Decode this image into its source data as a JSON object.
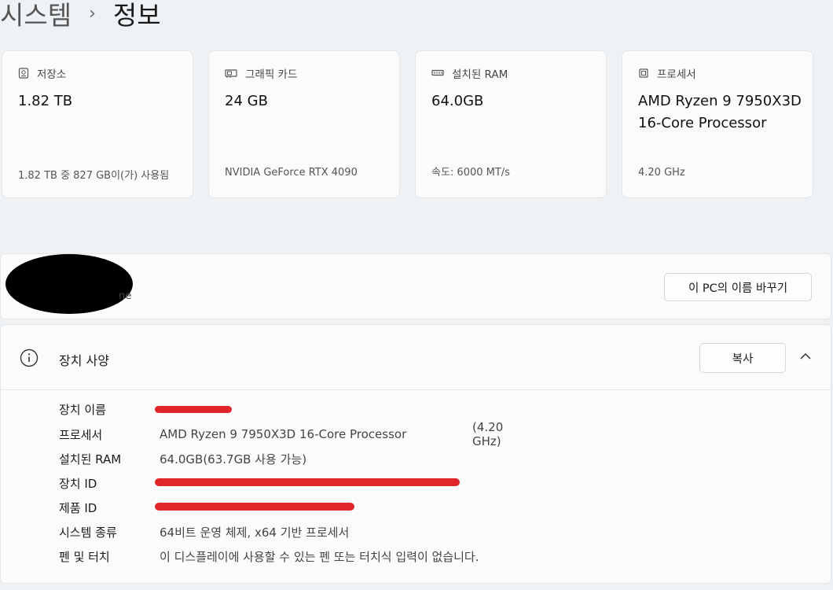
{
  "breadcrumb": {
    "parent": "시스템",
    "separator": "›",
    "current": "정보"
  },
  "cards": [
    {
      "icon": "storage-icon",
      "title": "저장소",
      "value": "1.82 TB",
      "sub": "1.82 TB 중 827 GB이(가) 사용됨"
    },
    {
      "icon": "graphics-card-icon",
      "title": "그래픽 카드",
      "value": "24 GB",
      "sub": "NVIDIA GeForce RTX 4090"
    },
    {
      "icon": "memory-icon",
      "title": "설치된 RAM",
      "value": "64.0GB",
      "sub": "속도: 6000 MT/s"
    },
    {
      "icon": "processor-icon",
      "title": "프로세서",
      "value": "AMD Ryzen 9 7950X3D 16-Core Processor",
      "sub": "4.20 GHz"
    }
  ],
  "pc_name": {
    "visible_tail": "ne",
    "rename_button": "이 PC의 이름 바꾸기"
  },
  "device_specs": {
    "title": "장치 사양",
    "copy_button": "복사",
    "rows": [
      {
        "label": "장치 이름",
        "value": ""
      },
      {
        "label": "프로세서",
        "value": "AMD Ryzen 9 7950X3D 16-Core Processor",
        "extra": "(4.20 GHz)"
      },
      {
        "label": "설치된 RAM",
        "value": "64.0GB(63.7GB 사용 가능)"
      },
      {
        "label": "장치 ID",
        "value": ""
      },
      {
        "label": "제품 ID",
        "value": ""
      },
      {
        "label": "시스템 종류",
        "value": "64비트 운영 체제, x64 기반 프로세서"
      },
      {
        "label": "펜 및 터치",
        "value": "이 디스플레이에 사용할 수 있는 펜 또는 터치식 입력이 없습니다."
      }
    ]
  },
  "colors": {
    "redaction_red": "#e0252b",
    "redaction_black": "#000000",
    "background": "#eef2f4"
  }
}
